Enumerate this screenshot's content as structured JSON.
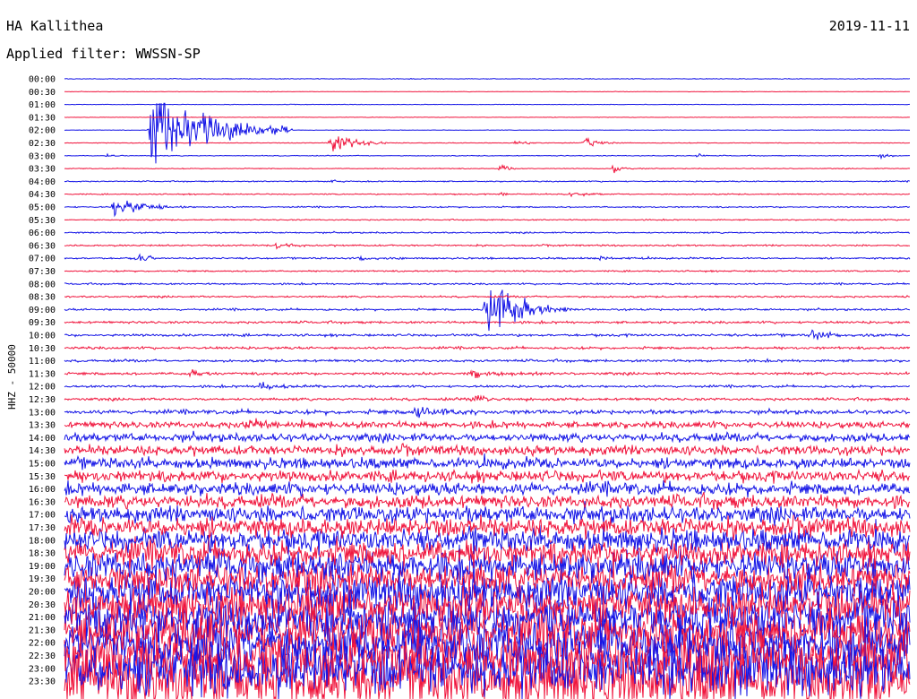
{
  "header": {
    "station": "HA Kallithea",
    "date": "2019-11-11",
    "filter": "Applied filter: WWSSN-SP"
  },
  "colors": {
    "trace_a": "#1414e6",
    "trace_b": "#f0143c",
    "text": "#000000",
    "background": "#ffffff"
  },
  "chart_data": {
    "type": "line",
    "title": "HA Kallithea",
    "ylabel": "HHZ - 50000",
    "row_labels": [
      "00:00",
      "00:30",
      "01:00",
      "01:30",
      "02:00",
      "02:30",
      "03:00",
      "03:30",
      "04:00",
      "04:30",
      "05:00",
      "05:30",
      "06:00",
      "06:30",
      "07:00",
      "07:30",
      "08:00",
      "08:30",
      "09:00",
      "09:30",
      "10:00",
      "10:30",
      "11:00",
      "11:30",
      "12:00",
      "12:30",
      "13:00",
      "13:30",
      "14:00",
      "14:30",
      "15:00",
      "15:30",
      "16:00",
      "16:30",
      "17:00",
      "17:30",
      "18:00",
      "18:30",
      "19:00",
      "19:30",
      "20:00",
      "20:30",
      "21:00",
      "21:30",
      "22:00",
      "22:30",
      "23:00",
      "23:30"
    ],
    "row_noise_level": [
      0.4,
      0.3,
      0.3,
      0.3,
      0.3,
      0.4,
      0.5,
      0.5,
      0.7,
      0.7,
      0.8,
      0.7,
      0.9,
      1.0,
      1.0,
      0.9,
      1.0,
      1.1,
      1.2,
      1.4,
      1.5,
      1.5,
      1.5,
      1.6,
      1.4,
      1.6,
      2.5,
      4.0,
      5.0,
      6.0,
      6.5,
      7.0,
      7.5,
      8.0,
      10,
      12,
      14,
      16,
      18,
      20,
      22,
      24,
      26,
      28,
      30,
      32,
      34,
      36
    ],
    "events": [
      {
        "row": 4,
        "minute": 3.1,
        "amplitude": 60,
        "duration": 5
      },
      {
        "row": 5,
        "minute": 9.5,
        "amplitude": 18,
        "duration": 2
      },
      {
        "row": 5,
        "minute": 16,
        "amplitude": 4,
        "duration": 1.5
      },
      {
        "row": 5,
        "minute": 18.5,
        "amplitude": 6,
        "duration": 1.5
      },
      {
        "row": 6,
        "minute": 1.5,
        "amplitude": 3,
        "duration": 1
      },
      {
        "row": 6,
        "minute": 22.5,
        "amplitude": 4,
        "duration": 0.5
      },
      {
        "row": 6,
        "minute": 29,
        "amplitude": 6,
        "duration": 0.5
      },
      {
        "row": 7,
        "minute": 15.5,
        "amplitude": 5,
        "duration": 1
      },
      {
        "row": 7,
        "minute": 19.5,
        "amplitude": 6,
        "duration": 1
      },
      {
        "row": 8,
        "minute": 9.5,
        "amplitude": 3,
        "duration": 1
      },
      {
        "row": 9,
        "minute": 15.5,
        "amplitude": 3,
        "duration": 1.5
      },
      {
        "row": 9,
        "minute": 18,
        "amplitude": 4,
        "duration": 1.5
      },
      {
        "row": 10,
        "minute": 1.8,
        "amplitude": 16,
        "duration": 2.5
      },
      {
        "row": 13,
        "minute": 7.5,
        "amplitude": 6,
        "duration": 1.5
      },
      {
        "row": 13,
        "minute": 31.5,
        "amplitude": 5,
        "duration": 2
      },
      {
        "row": 14,
        "minute": 2.6,
        "amplitude": 5,
        "duration": 1.5
      },
      {
        "row": 14,
        "minute": 10.5,
        "amplitude": 4,
        "duration": 1.5
      },
      {
        "row": 14,
        "minute": 19,
        "amplitude": 4,
        "duration": 1.5
      },
      {
        "row": 18,
        "minute": 15,
        "amplitude": 45,
        "duration": 3
      },
      {
        "row": 20,
        "minute": 26.5,
        "amplitude": 8,
        "duration": 2
      },
      {
        "row": 23,
        "minute": 4.5,
        "amplitude": 5,
        "duration": 2
      },
      {
        "row": 23,
        "minute": 14.5,
        "amplitude": 6,
        "duration": 3
      },
      {
        "row": 24,
        "minute": 7,
        "amplitude": 7,
        "duration": 2
      },
      {
        "row": 25,
        "minute": 14.5,
        "amplitude": 6,
        "duration": 2
      },
      {
        "row": 26,
        "minute": 12.5,
        "amplitude": 10,
        "duration": 3
      },
      {
        "row": 27,
        "minute": 6.5,
        "amplitude": 10,
        "duration": 2
      }
    ],
    "grid": false
  }
}
